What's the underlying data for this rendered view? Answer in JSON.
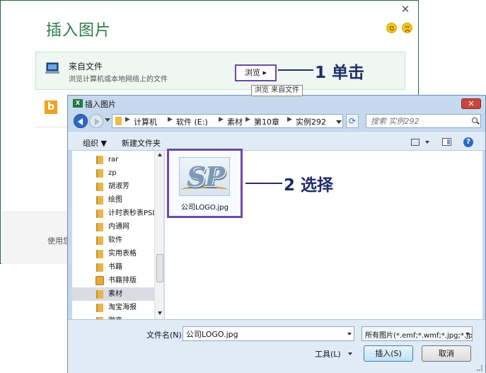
{
  "background_panel": {
    "title": "插入图片",
    "from_file": {
      "title": "来自文件",
      "description": "浏览计算机或本地网络上的文件",
      "browse_label": "浏览 ▸",
      "browse_tooltip": "浏览 来自文件"
    },
    "footer_text": "使用您"
  },
  "annotations": {
    "step1": "1 单击",
    "step2": "2 选择",
    "color": "#1f2d6b",
    "highlight_color": "#6a4aa5"
  },
  "dialog": {
    "title": "插入图片",
    "close_label": "✕",
    "breadcrumb": [
      "计算机",
      "软件 (E:)",
      "素材",
      "第10章",
      "实例292"
    ],
    "search_placeholder": "搜索 实例292",
    "toolbar": {
      "organize": "组织 ▼",
      "new_folder": "新建文件夹"
    },
    "nav_items": [
      {
        "label": "rar",
        "icon": "folder-icon",
        "selected": false
      },
      {
        "label": "zp",
        "icon": "folder-icon",
        "selected": false
      },
      {
        "label": "胡淑芳",
        "icon": "folder-icon",
        "selected": false
      },
      {
        "label": "绘图",
        "icon": "folder-icon",
        "selected": false
      },
      {
        "label": "计时表秒表PSD",
        "icon": "folder-icon",
        "selected": false
      },
      {
        "label": "内通网",
        "icon": "folder-icon",
        "selected": false
      },
      {
        "label": "软件",
        "icon": "folder-icon",
        "selected": false
      },
      {
        "label": "实用表格",
        "icon": "folder-icon",
        "selected": false
      },
      {
        "label": "书籍",
        "icon": "folder-icon",
        "selected": false
      },
      {
        "label": "书籍排版",
        "icon": "archive-icon",
        "selected": false
      },
      {
        "label": "素材",
        "icon": "folder-icon",
        "selected": true
      },
      {
        "label": "淘宝海报",
        "icon": "folder-icon",
        "selected": false
      },
      {
        "label": "微商",
        "icon": "folder-icon",
        "selected": false
      }
    ],
    "file": {
      "name": "公司LOGO.jpg",
      "logo_text": "SP"
    },
    "bottom": {
      "filename_label": "文件名(N):",
      "filename_value": "公司LOGO.jpg",
      "filetype_value": "所有图片(*.emf;*.wmf;*.jpg;*.jp",
      "tools_label": "工具(L)",
      "insert_label": "插入(S)",
      "cancel_label": "取消"
    }
  }
}
